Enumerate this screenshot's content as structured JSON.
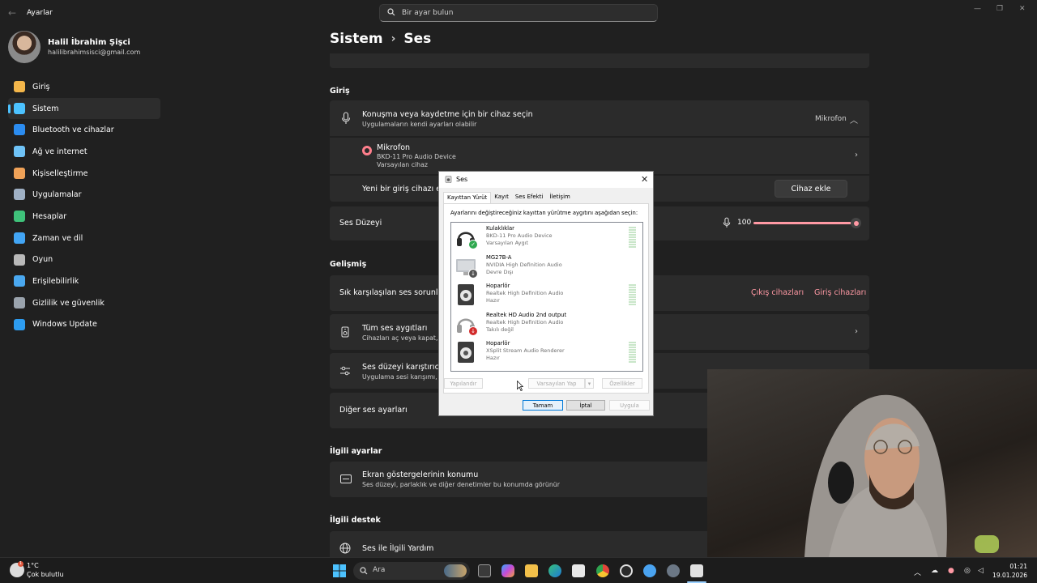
{
  "window": {
    "app_title": "Ayarlar",
    "search_placeholder": "Bir ayar bulun"
  },
  "profile": {
    "name": "Halil İbrahim Şişci",
    "email": "halilibrahimsisci@gmail.com"
  },
  "sidebar": {
    "items": [
      {
        "label": "Giriş",
        "icon": "home-icon",
        "color": "#f3b64a"
      },
      {
        "label": "Sistem",
        "icon": "system-icon",
        "color": "#4cc2ff",
        "active": true
      },
      {
        "label": "Bluetooth ve cihazlar",
        "icon": "bluetooth-icon",
        "color": "#2b8cf0"
      },
      {
        "label": "Ağ ve internet",
        "icon": "network-icon",
        "color": "#6fc3f7"
      },
      {
        "label": "Kişiselleştirme",
        "icon": "brush-icon",
        "color": "#f0a258"
      },
      {
        "label": "Uygulamalar",
        "icon": "apps-icon",
        "color": "#9fb0c4"
      },
      {
        "label": "Hesaplar",
        "icon": "accounts-icon",
        "color": "#3fc27a"
      },
      {
        "label": "Zaman ve dil",
        "icon": "globe-clock-icon",
        "color": "#42a5f5"
      },
      {
        "label": "Oyun",
        "icon": "gamepad-icon",
        "color": "#b9b9b9"
      },
      {
        "label": "Erişilebilirlik",
        "icon": "accessibility-icon",
        "color": "#4aa8f0"
      },
      {
        "label": "Gizlilik ve güvenlik",
        "icon": "shield-icon",
        "color": "#9aa3ad"
      },
      {
        "label": "Windows Update",
        "icon": "update-icon",
        "color": "#2d9cf0"
      }
    ]
  },
  "breadcrumb": {
    "parent": "Sistem",
    "separator": "›",
    "current": "Ses"
  },
  "giris": {
    "heading": "Giriş",
    "select_title": "Konuşma veya kaydetme için bir cihaz seçin",
    "select_subtitle": "Uygulamaların kendi ayarları olabilir",
    "select_value": "Mikrofon",
    "device_name": "Mikrofon",
    "device_detail": "BKD-11 Pro Audio Device",
    "device_default": "Varsayılan cihaz",
    "pair_label": "Yeni bir giriş cihazı eşle",
    "add_device_button": "Cihaz ekle",
    "volume_label": "Ses Düzeyi",
    "volume_value": "100",
    "volume_level": 1.0
  },
  "gelismis": {
    "heading": "Gelişmiş",
    "troubleshoot_label": "Sık karşılaşılan ses sorunlarını",
    "output_link": "Çıkış cihazları",
    "input_link": "Giriş cihazları",
    "all_devices_title": "Tüm ses aygıtları",
    "all_devices_subtitle": "Cihazları aç veya kapat, so",
    "mixer_title": "Ses düzeyi karıştırıcı",
    "mixer_subtitle": "Uygulama sesi karışımı, uy",
    "more_settings": "Diğer ses ayarları"
  },
  "ilgili_ayarlar": {
    "heading": "İlgili ayarlar",
    "title": "Ekran göstergelerinin konumu",
    "subtitle": "Ses düzeyi, parlaklık ve diğer denetimler bu konumda görünür"
  },
  "ilgili_destek": {
    "heading": "İlgili destek",
    "title": "Ses ile İlgili Yardım"
  },
  "dialog": {
    "title": "Ses",
    "tabs": [
      "Kayıttan Yürüt",
      "Kayıt",
      "Ses Efekti",
      "İletişim"
    ],
    "instruction": "Ayarlarını değiştireceğiniz kayıttan yürütme aygıtını aşağıdan seçin:",
    "devices": [
      {
        "name": "Kulaklıklar",
        "detail": "BKD-11 Pro Audio Device",
        "status": "Varsayılan Aygıt",
        "icon": "headphones-icon",
        "badge": "default"
      },
      {
        "name": "MG27B-A",
        "detail": "NVIDIA High Definition Audio",
        "status": "Devre Dışı",
        "icon": "monitor-icon",
        "badge": "disabled"
      },
      {
        "name": "Hoparlör",
        "detail": "Realtek High Definition Audio",
        "status": "Hazır",
        "icon": "speaker-icon",
        "badge": "none"
      },
      {
        "name": "Realtek HD Audio 2nd output",
        "detail": "Realtek High Definition Audio",
        "status": "Takılı değil",
        "icon": "headphones-icon",
        "badge": "unplugged"
      },
      {
        "name": "Hoparlör",
        "detail": "XSplit Stream Audio Renderer",
        "status": "Hazır",
        "icon": "speaker-icon",
        "badge": "none"
      }
    ],
    "configure_button": "Yapılandır",
    "set_default_button": "Varsayılan Yap",
    "properties_button": "Özellikler",
    "ok_button": "Tamam",
    "cancel_button": "İptal",
    "apply_button": "Uygula"
  },
  "taskbar": {
    "weather_temp": "1°C",
    "weather_desc": "Çok bulutlu",
    "search_label": "Ara",
    "time": "01:21",
    "date": "19.01.2026"
  }
}
